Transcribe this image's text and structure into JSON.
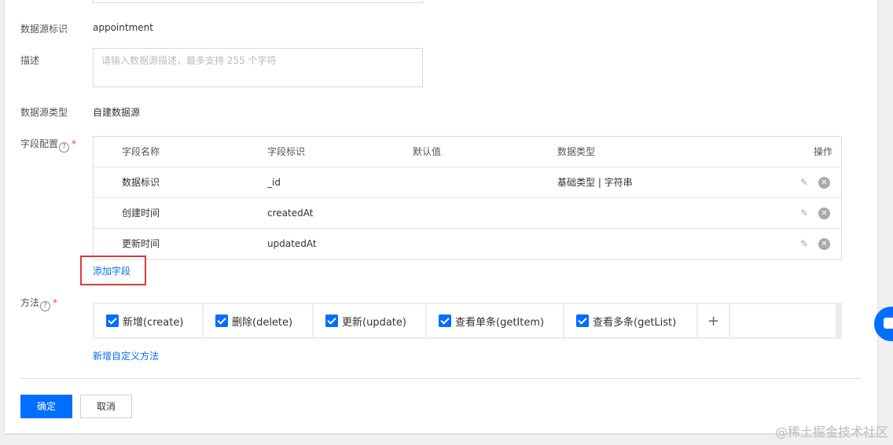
{
  "form": {
    "datasource_id_label": "数据源标识",
    "datasource_id_value": "appointment",
    "description_label": "描述",
    "description_placeholder": "请输入数据源描述，最多支持 255 个字符",
    "datasource_type_label": "数据源类型",
    "datasource_type_value": "自建数据源",
    "fields_label": "字段配置",
    "methods_label": "方法",
    "required_mark": "*",
    "help_glyph": "?"
  },
  "fields_table": {
    "headers": [
      "字段名称",
      "字段标识",
      "默认值",
      "数据类型",
      "操作"
    ],
    "rows": [
      {
        "name": "数据标识",
        "id": "_id",
        "default": "",
        "type": "基础类型 | 字符串"
      },
      {
        "name": "创建时间",
        "id": "createdAt",
        "default": "",
        "type": ""
      },
      {
        "name": "更新时间",
        "id": "updatedAt",
        "default": "",
        "type": ""
      }
    ],
    "delete_glyph": "✕",
    "edit_glyph": "✎"
  },
  "add_field_link": "添加字段",
  "methods": [
    {
      "label": "新增(create)",
      "checked": true
    },
    {
      "label": "删除(delete)",
      "checked": true
    },
    {
      "label": "更新(update)",
      "checked": true
    },
    {
      "label": "查看单条(getItem)",
      "checked": true
    },
    {
      "label": "查看多条(getList)",
      "checked": true
    }
  ],
  "add_method_glyph": "+",
  "add_custom_method_link": "新增自定义方法",
  "buttons": {
    "confirm": "确定",
    "cancel": "取消"
  },
  "watermark": "@稀土掘金技术社区",
  "icons": {
    "edit": "pencil-icon",
    "delete": "close-circle-icon",
    "help": "question-circle-icon",
    "chat": "chat-icon"
  },
  "colors": {
    "primary": "#006eff",
    "highlight_box": "#e03a3a",
    "required": "#e54545"
  }
}
